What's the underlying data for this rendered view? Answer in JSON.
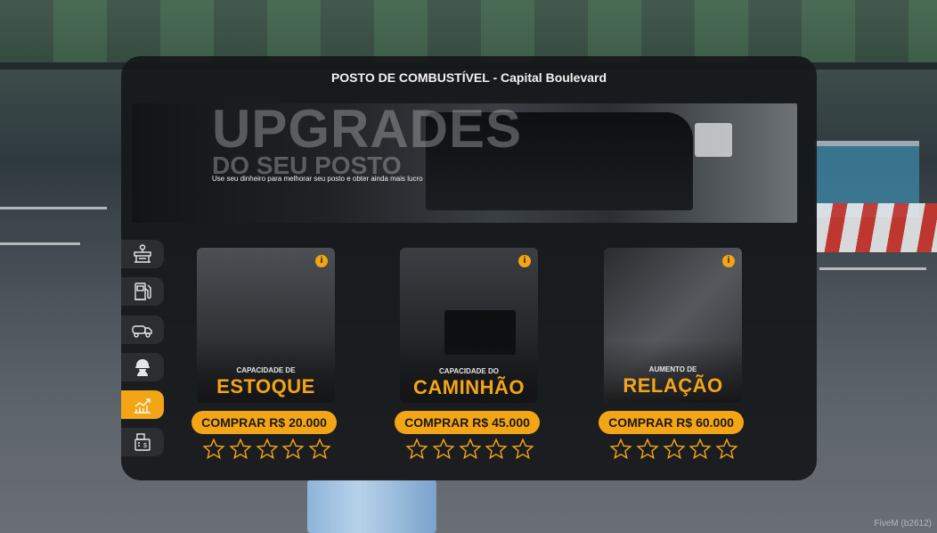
{
  "panel": {
    "title": "POSTO DE COMBUSTÍVEL - Capital Boulevard"
  },
  "banner": {
    "headline": "UPGRADES",
    "subheadline": "DO SEU POSTO",
    "description": "Use seu dinheiro para melhorar seu posto e obter ainda mais lucro"
  },
  "sidebar": {
    "items": [
      {
        "icon": "gas-station-location-icon",
        "active": false
      },
      {
        "icon": "fuel-pump-icon",
        "active": false
      },
      {
        "icon": "tanker-truck-icon",
        "active": false
      },
      {
        "icon": "worker-helmet-icon",
        "active": false
      },
      {
        "icon": "growth-chart-icon",
        "active": true
      },
      {
        "icon": "cash-register-icon",
        "active": false
      }
    ]
  },
  "cards": [
    {
      "caption_small": "CAPACIDADE DE",
      "caption_big": "ESTOQUE",
      "button": "COMPRAR R$ 20.000",
      "stars_filled": 0,
      "stars_total": 5
    },
    {
      "caption_small": "CAPACIDADE DO",
      "caption_big": "CAMINHÃO",
      "button": "COMPRAR R$ 45.000",
      "stars_filled": 0,
      "stars_total": 5
    },
    {
      "caption_small": "AUMENTO DE",
      "caption_big": "RELAÇÃO",
      "button": "COMPRAR R$ 60.000",
      "stars_filled": 0,
      "stars_total": 5
    }
  ],
  "watermark": "FiveM (b2612)",
  "colors": {
    "accent": "#f4a516",
    "panel": "#16181a",
    "sidebar_item": "#2b2e31"
  }
}
